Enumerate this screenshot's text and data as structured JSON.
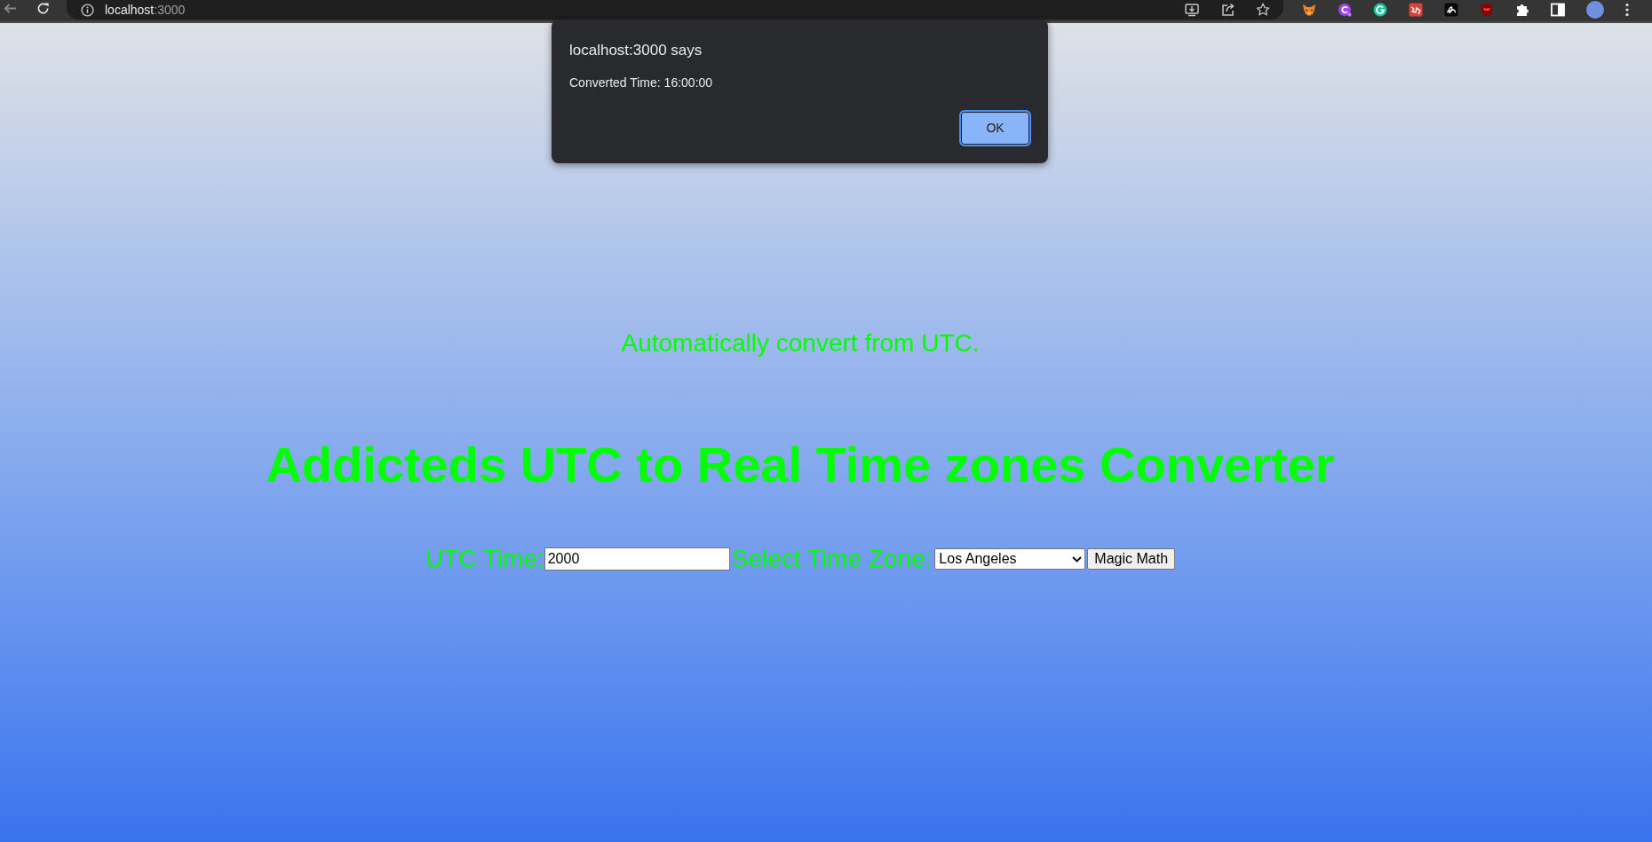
{
  "browser": {
    "url": {
      "host": "localhost",
      "port": ":3000"
    }
  },
  "page": {
    "subtitle": "Automatically convert from UTC.",
    "title": "Addicteds UTC to Real Time zones Converter",
    "form": {
      "utc_label": "UTC Time:",
      "utc_input": {
        "value": "2000"
      },
      "zone_label": "Select Time Zone:",
      "zone_select": {
        "value": "Los Angeles"
      },
      "submit_button": "Magic Math"
    }
  },
  "dialog": {
    "title": "localhost:3000 says",
    "message": "Converted Time: 16:00:00",
    "button": "OK"
  }
}
